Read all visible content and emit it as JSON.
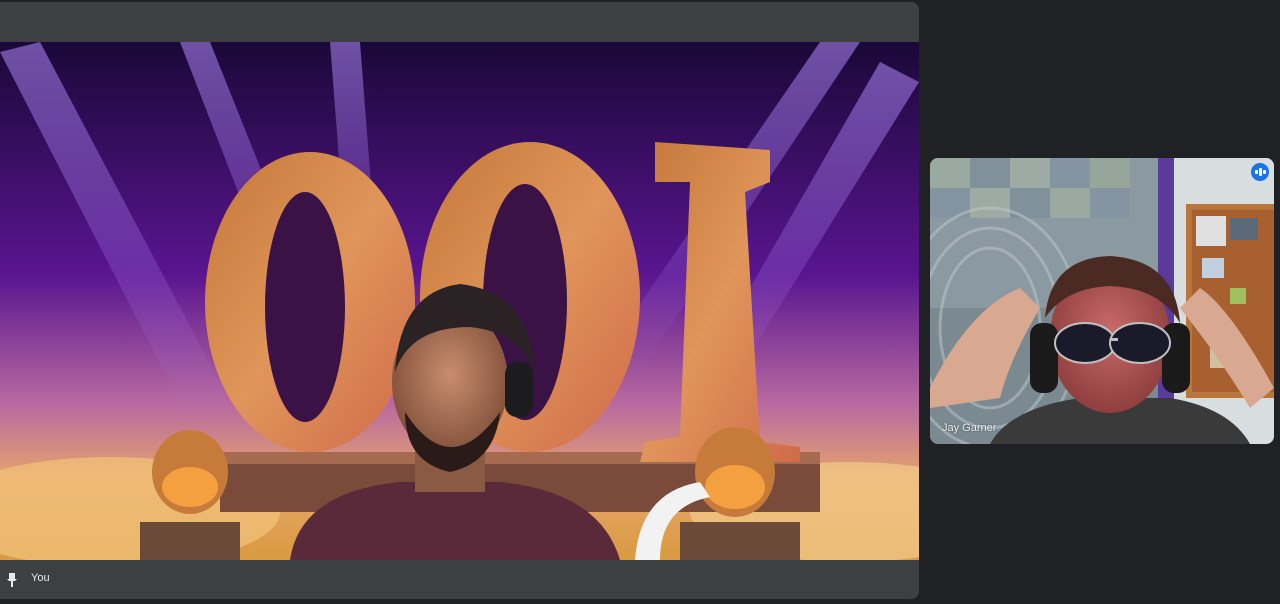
{
  "main_tile": {
    "self_label": "You",
    "background_scene_text": "100",
    "colors": {
      "tile_bar": "#3c4043",
      "page_bg": "#202124"
    }
  },
  "remote_tile": {
    "participant_name": "Jay Garner",
    "speaking_indicator_color": "#1a73e8"
  },
  "icons": {
    "pin": "pin-icon",
    "speaking": "audio-level-icon"
  }
}
